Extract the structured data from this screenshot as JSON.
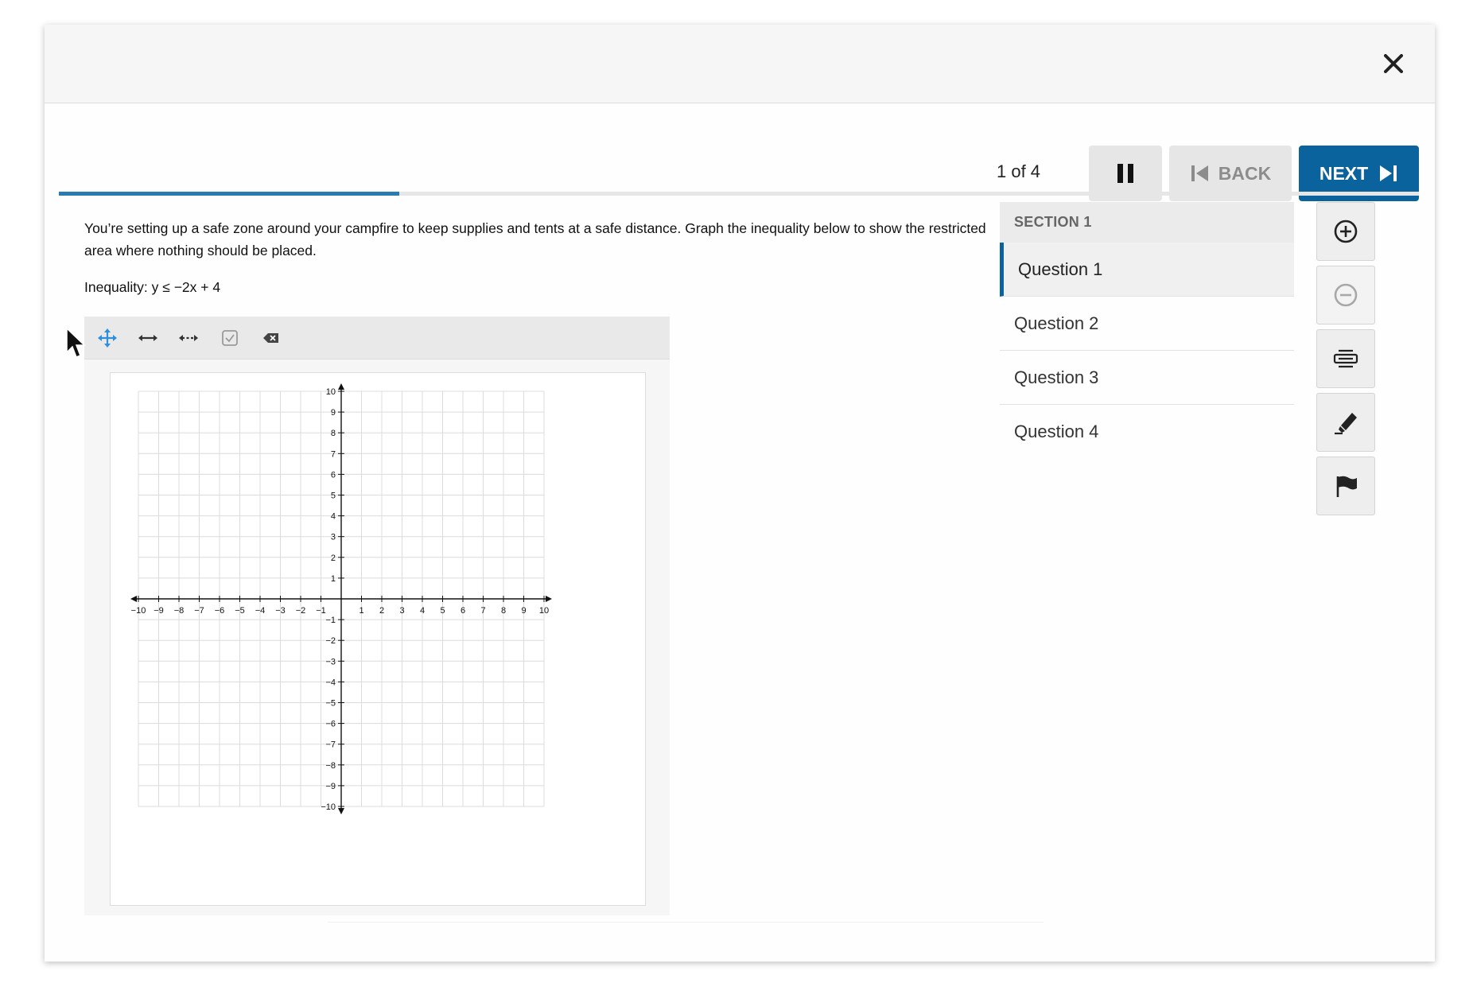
{
  "header": {
    "close_icon": "close-icon"
  },
  "nav": {
    "counter": "1 of 4",
    "pause_icon": "pause-icon",
    "back_label": "BACK",
    "next_label": "NEXT",
    "progress_fraction": 0.25,
    "colors": {
      "accent": "#0b639d",
      "progress": "#2a7bb1",
      "button_bg": "#e6e6e6"
    }
  },
  "question": {
    "text": "You’re setting up a safe zone around your campfire to keep supplies and tents at a safe distance. Graph the inequality below to show the restricted area where nothing should be placed.",
    "inequality": "Inequality: y ≤ −2x + 4"
  },
  "graph_tools": [
    "move-tool-icon",
    "line-tool-icon",
    "dashed-line-tool-icon",
    "check-tool-icon",
    "delete-tool-icon"
  ],
  "graph": {
    "x_range": [
      -10,
      10
    ],
    "y_range": [
      -10,
      10
    ],
    "x_ticks": [
      "−10",
      "−9",
      "−8",
      "−7",
      "−6",
      "−5",
      "−4",
      "−3",
      "−2",
      "−1",
      "1",
      "2",
      "3",
      "4",
      "5",
      "6",
      "7",
      "8",
      "9",
      "10"
    ],
    "y_ticks": [
      "10",
      "9",
      "8",
      "7",
      "6",
      "5",
      "4",
      "3",
      "2",
      "1",
      "−1",
      "−2",
      "−3",
      "−4",
      "−5",
      "−6",
      "−7",
      "−8",
      "−9",
      "−10"
    ]
  },
  "sidebar": {
    "section_title": "SECTION 1",
    "questions": [
      {
        "label": "Question 1"
      },
      {
        "label": "Question 2"
      },
      {
        "label": "Question 3"
      },
      {
        "label": "Question 4"
      }
    ],
    "active_index": 0
  },
  "side_tools": [
    "zoom-in-icon",
    "zoom-out-icon",
    "line-reader-icon",
    "highlighter-icon",
    "flag-icon"
  ]
}
